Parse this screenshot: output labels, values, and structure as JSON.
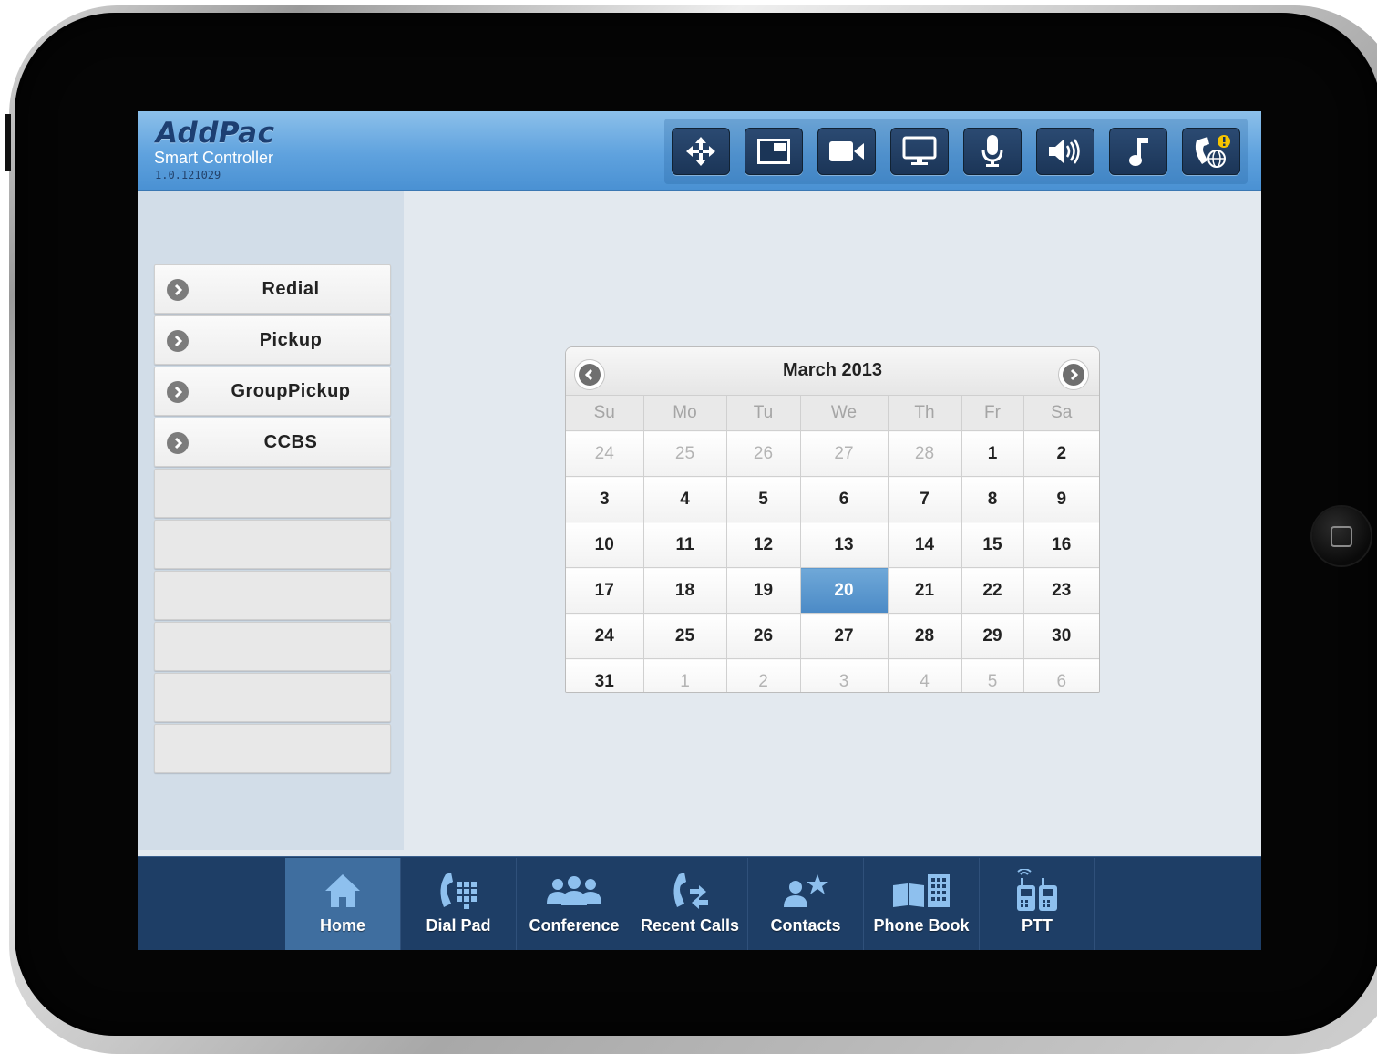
{
  "header": {
    "brand": "AddPac",
    "subtitle": "Smart Controller",
    "version": "1.0.121029",
    "toolbar": [
      {
        "icon": "move-arrows-icon"
      },
      {
        "icon": "picture-in-picture-icon"
      },
      {
        "icon": "video-camera-icon"
      },
      {
        "icon": "monitor-icon"
      },
      {
        "icon": "microphone-icon"
      },
      {
        "icon": "speaker-volume-icon"
      },
      {
        "icon": "music-note-icon"
      },
      {
        "icon": "phone-globe-alert-icon"
      }
    ]
  },
  "sidebar": {
    "items": [
      {
        "label": "Redial"
      },
      {
        "label": "Pickup"
      },
      {
        "label": "GroupPickup"
      },
      {
        "label": "CCBS"
      }
    ],
    "empty_rows": 6
  },
  "calendar": {
    "title": "March 2013",
    "weekdays": [
      "Su",
      "Mo",
      "Tu",
      "We",
      "Th",
      "Fr",
      "Sa"
    ],
    "selected": "20",
    "weeks": [
      [
        {
          "d": "24",
          "o": true
        },
        {
          "d": "25",
          "o": true
        },
        {
          "d": "26",
          "o": true
        },
        {
          "d": "27",
          "o": true
        },
        {
          "d": "28",
          "o": true
        },
        {
          "d": "1"
        },
        {
          "d": "2"
        }
      ],
      [
        {
          "d": "3"
        },
        {
          "d": "4"
        },
        {
          "d": "5"
        },
        {
          "d": "6"
        },
        {
          "d": "7"
        },
        {
          "d": "8"
        },
        {
          "d": "9"
        }
      ],
      [
        {
          "d": "10"
        },
        {
          "d": "11"
        },
        {
          "d": "12"
        },
        {
          "d": "13"
        },
        {
          "d": "14"
        },
        {
          "d": "15"
        },
        {
          "d": "16"
        }
      ],
      [
        {
          "d": "17"
        },
        {
          "d": "18"
        },
        {
          "d": "19"
        },
        {
          "d": "20"
        },
        {
          "d": "21"
        },
        {
          "d": "22"
        },
        {
          "d": "23"
        }
      ],
      [
        {
          "d": "24"
        },
        {
          "d": "25"
        },
        {
          "d": "26"
        },
        {
          "d": "27"
        },
        {
          "d": "28"
        },
        {
          "d": "29"
        },
        {
          "d": "30"
        }
      ],
      [
        {
          "d": "31"
        },
        {
          "d": "1",
          "o": true
        },
        {
          "d": "2",
          "o": true
        },
        {
          "d": "3",
          "o": true
        },
        {
          "d": "4",
          "o": true
        },
        {
          "d": "5",
          "o": true
        },
        {
          "d": "6",
          "o": true
        }
      ]
    ]
  },
  "bottom_nav": {
    "active": "Home",
    "items": [
      {
        "label": "Home",
        "icon": "home-icon"
      },
      {
        "label": "Dial Pad",
        "icon": "dial-pad-icon"
      },
      {
        "label": "Conference",
        "icon": "conference-icon"
      },
      {
        "label": "Recent Calls",
        "icon": "recent-calls-icon"
      },
      {
        "label": "Contacts",
        "icon": "contacts-icon"
      },
      {
        "label": "Phone Book",
        "icon": "phone-book-icon"
      },
      {
        "label": "PTT",
        "icon": "ptt-icon"
      }
    ]
  },
  "colors": {
    "header_blue": "#5fa2de",
    "nav_dark": "#1e3e66",
    "nav_active": "#3f6e9f",
    "selected_day": "#4b8ac6"
  }
}
